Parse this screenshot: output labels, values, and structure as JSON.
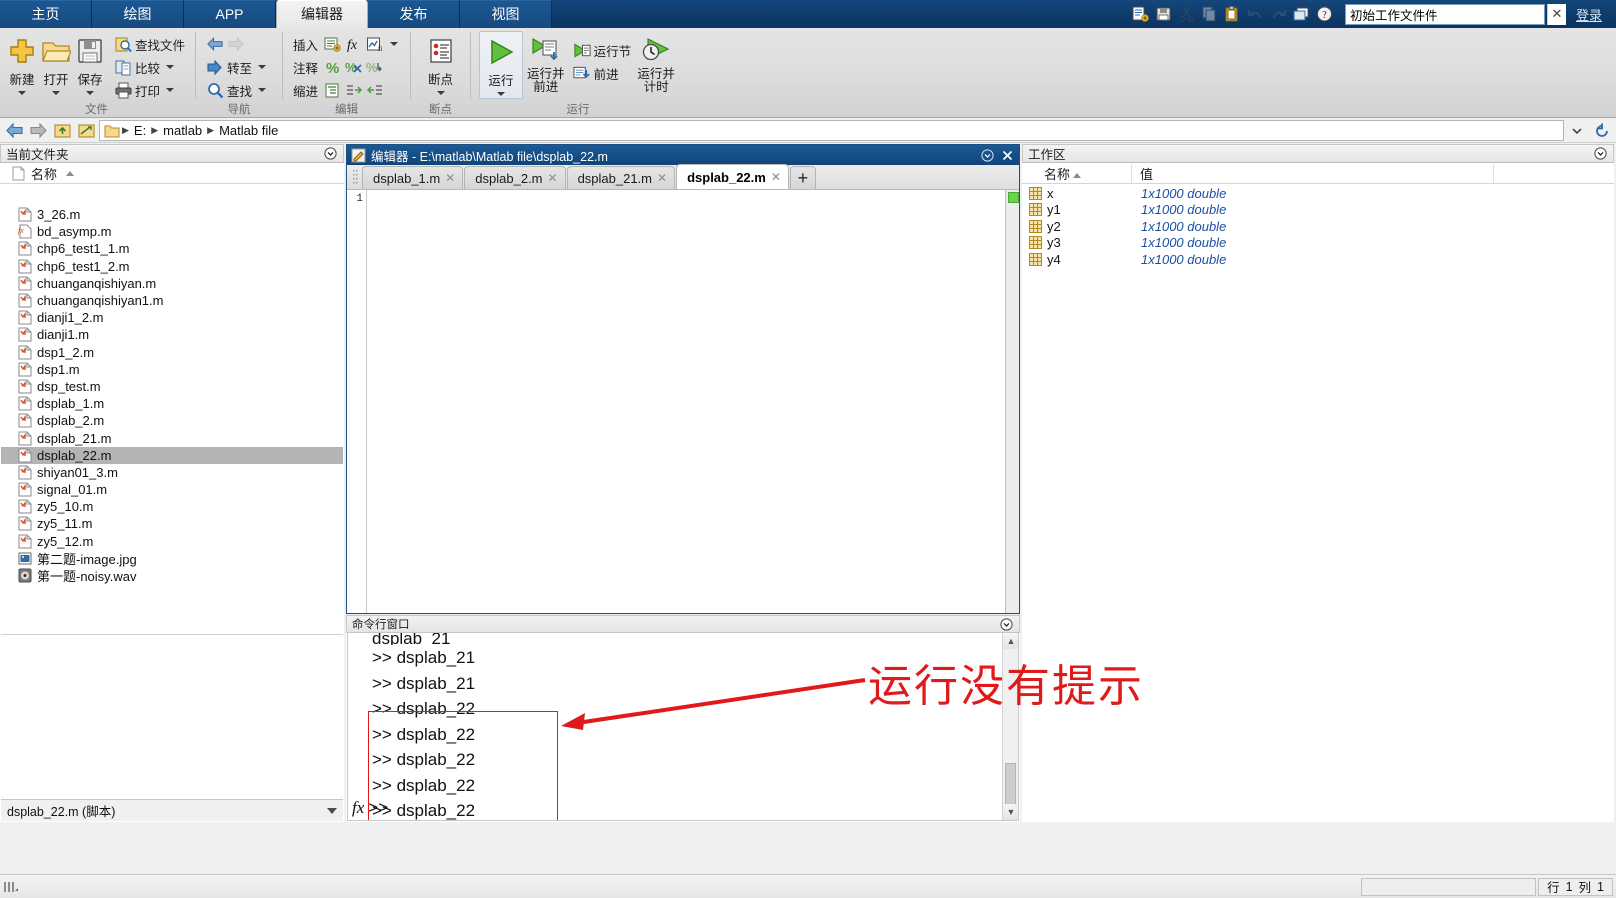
{
  "ribbon": {
    "tabs": [
      {
        "label": "主页",
        "active": false
      },
      {
        "label": "绘图",
        "active": false
      },
      {
        "label": "APP",
        "active": false
      },
      {
        "label": "编辑器",
        "active": true
      },
      {
        "label": "发布",
        "active": false
      },
      {
        "label": "视图",
        "active": false
      }
    ],
    "quick_access": {
      "icons": [
        "new-script-icon",
        "save-icon",
        "cut-icon",
        "copy-icon",
        "paste-icon",
        "undo-icon",
        "redo-icon",
        "window-layout-icon",
        "help-icon"
      ],
      "search_value": "初始工作文件件",
      "clear_label": "✕",
      "login_label": "登录"
    },
    "groups": [
      {
        "name": "文件",
        "big_buttons": [
          {
            "label": "新建",
            "icon": "new-file-icon",
            "has_caret": true
          },
          {
            "label": "打开",
            "icon": "open-folder-icon",
            "has_caret": true
          },
          {
            "label": "保存",
            "icon": "save-disk-icon",
            "has_caret": true
          }
        ],
        "small_buttons": [
          {
            "label": "查找文件",
            "icon": "find-files-icon",
            "has_caret": false
          },
          {
            "label": "比较",
            "icon": "compare-icon",
            "has_caret": true
          },
          {
            "label": "打印",
            "icon": "print-icon",
            "has_caret": true
          }
        ]
      },
      {
        "name": "导航",
        "small_buttons": [
          {
            "label": "",
            "icon": "back-arrow-icon",
            "has_caret": false
          },
          {
            "label": "转至",
            "icon": "goto-icon",
            "has_caret": true
          },
          {
            "label": "查找",
            "icon": "search-magnifier-icon",
            "has_caret": true
          }
        ]
      },
      {
        "name": "编辑",
        "rows": [
          {
            "label": "插入",
            "icons": [
              "insert-section-icon",
              "insert-function-icon",
              "insert-figure-icon"
            ],
            "has_caret": true
          },
          {
            "label": "注释",
            "icons": [
              "comment-percent-icon",
              "uncomment-icon",
              "wrap-comment-icon"
            ],
            "has_caret": false
          },
          {
            "label": "缩进",
            "icons": [
              "smart-indent-icon",
              "indent-right-icon",
              "indent-left-icon"
            ],
            "has_caret": false
          }
        ]
      },
      {
        "name": "断点",
        "big_buttons": [
          {
            "label": "断点",
            "icon": "breakpoint-icon",
            "has_caret": true
          }
        ]
      },
      {
        "name": "运行",
        "big_buttons": [
          {
            "label": "运行",
            "icon": "run-play-icon",
            "has_caret": true,
            "highlighted": true
          },
          {
            "label": "运行并",
            "label2": "前进",
            "icon": "run-advance-icon",
            "has_caret": false
          },
          {
            "label": "运行并",
            "label2": "计时",
            "icon": "run-time-icon",
            "has_caret": false
          }
        ],
        "small_buttons": [
          {
            "label": "运行节",
            "icon": "run-section-icon"
          },
          {
            "label": "前进",
            "icon": "advance-icon"
          }
        ]
      }
    ]
  },
  "address_bar": {
    "nav_icons": [
      "back-icon",
      "forward-icon",
      "up-folder-icon",
      "browse-folder-icon"
    ],
    "folder_icon": "folder-icon",
    "breadcrumbs": [
      "E:",
      "matlab",
      "Matlab file"
    ],
    "dropdown_icon": "chevron-down-icon",
    "refresh_icon": "refresh-icon"
  },
  "current_folder": {
    "title": "当前文件夹",
    "column_header": "名称",
    "sort_icon": "sort-ascending-icon",
    "doc_icon": "document-icon",
    "files": [
      {
        "name": "3_26.m",
        "icon": "m-file-icon",
        "selected": false
      },
      {
        "name": "bd_asymp.m",
        "icon": "m-function-icon",
        "selected": false
      },
      {
        "name": "chp6_test1_1.m",
        "icon": "m-file-icon",
        "selected": false
      },
      {
        "name": "chp6_test1_2.m",
        "icon": "m-file-icon",
        "selected": false
      },
      {
        "name": "chuanganqishiyan.m",
        "icon": "m-file-icon",
        "selected": false
      },
      {
        "name": "chuanganqishiyan1.m",
        "icon": "m-file-icon",
        "selected": false
      },
      {
        "name": "dianji1_2.m",
        "icon": "m-file-icon",
        "selected": false
      },
      {
        "name": "dianji1.m",
        "icon": "m-file-icon",
        "selected": false
      },
      {
        "name": "dsp1_2.m",
        "icon": "m-file-icon",
        "selected": false
      },
      {
        "name": "dsp1.m",
        "icon": "m-file-icon",
        "selected": false
      },
      {
        "name": "dsp_test.m",
        "icon": "m-file-icon",
        "selected": false
      },
      {
        "name": "dsplab_1.m",
        "icon": "m-file-icon",
        "selected": false
      },
      {
        "name": "dsplab_2.m",
        "icon": "m-file-icon",
        "selected": false
      },
      {
        "name": "dsplab_21.m",
        "icon": "m-file-icon",
        "selected": false
      },
      {
        "name": "dsplab_22.m",
        "icon": "m-file-icon",
        "selected": true
      },
      {
        "name": "shiyan01_3.m",
        "icon": "m-file-icon",
        "selected": false
      },
      {
        "name": "signal_01.m",
        "icon": "m-file-icon",
        "selected": false
      },
      {
        "name": "zy5_10.m",
        "icon": "m-file-icon",
        "selected": false
      },
      {
        "name": "zy5_11.m",
        "icon": "m-file-icon",
        "selected": false
      },
      {
        "name": "zy5_12.m",
        "icon": "m-file-icon",
        "selected": false
      },
      {
        "name": "第二题-image.jpg",
        "icon": "image-file-icon",
        "selected": false
      },
      {
        "name": "第一题-noisy.wav",
        "icon": "audio-file-icon",
        "selected": false
      }
    ],
    "detail_label": "dsplab_22.m  (脚本)",
    "collapse_icon": "chevron-down-icon"
  },
  "editor": {
    "title": "编辑器 - E:\\matlab\\Matlab file\\dsplab_22.m",
    "title_icon": "editor-pencil-icon",
    "minimize_icon": "panel-menu-icon",
    "close_icon": "close-icon",
    "tabs": [
      {
        "label": "dsplab_1.m",
        "active": false,
        "close": "✕"
      },
      {
        "label": "dsplab_2.m",
        "active": false,
        "close": "✕"
      },
      {
        "label": "dsplab_21.m",
        "active": false,
        "close": "✕"
      },
      {
        "label": "dsplab_22.m",
        "active": true,
        "close": "✕"
      }
    ],
    "add_tab_label": "+",
    "line_numbers": [
      "1"
    ],
    "code_lines": [
      ""
    ],
    "health_color": "#69d34a"
  },
  "command_window": {
    "title": "命令行窗口",
    "menu_icon": "panel-menu-icon",
    "clipped_line": "dsplab_21",
    "lines": [
      ">> dsplab_21",
      ">> dsplab_21",
      ">> dsplab_22",
      ">> dsplab_22",
      ">> dsplab_22",
      ">> dsplab_22",
      ">> dsplab_22"
    ],
    "prompt": ">>",
    "prompt_icon": "fx-icon",
    "scroll_up_icon": "▲",
    "scroll_down_icon": "▼"
  },
  "workspace": {
    "title": "工作区",
    "menu_icon": "panel-menu-icon",
    "columns": [
      "名称",
      "值"
    ],
    "sort_icon": "sort-ascending-icon",
    "variables": [
      {
        "name": "x",
        "value": "1x1000 double",
        "icon": "matrix-icon"
      },
      {
        "name": "y1",
        "value": "1x1000 double",
        "icon": "matrix-icon"
      },
      {
        "name": "y2",
        "value": "1x1000 double",
        "icon": "matrix-icon"
      },
      {
        "name": "y3",
        "value": "1x1000 double",
        "icon": "matrix-icon"
      },
      {
        "name": "y4",
        "value": "1x1000 double",
        "icon": "matrix-icon"
      }
    ]
  },
  "annotation": {
    "text": "运行没有提示",
    "color": "#e01a1a",
    "arrow_icon": "arrow-left-icon"
  },
  "status_bar": {
    "grip_icon": "resize-grip-icon",
    "row_label": "行",
    "row_value": "1",
    "col_label": "列",
    "col_value": "1"
  }
}
